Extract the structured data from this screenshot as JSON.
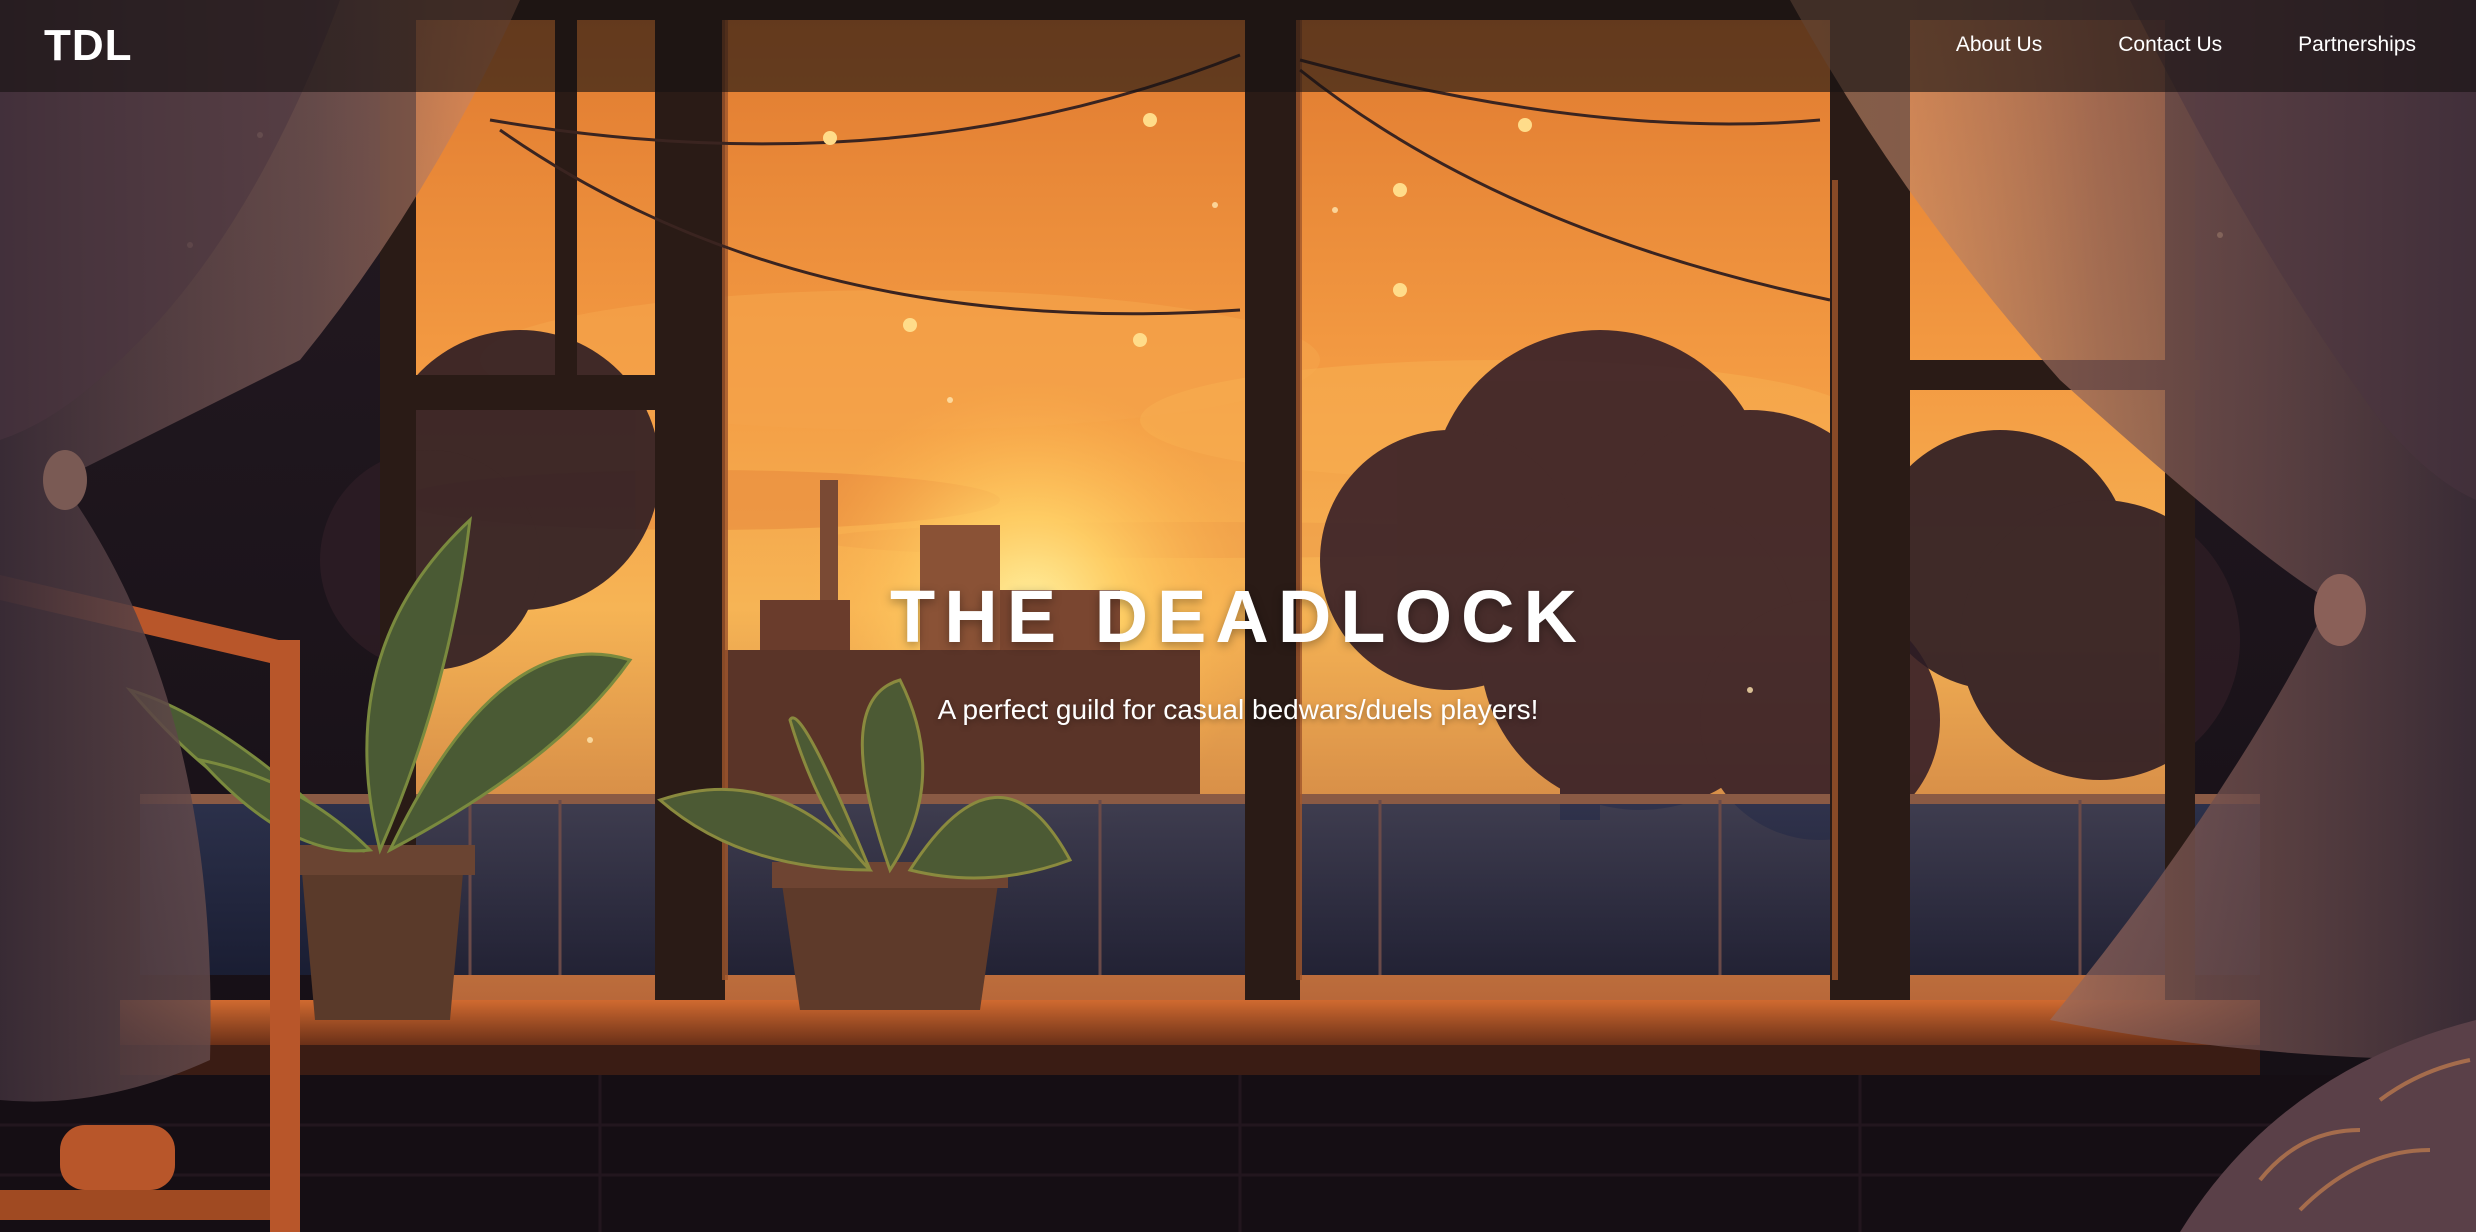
{
  "header": {
    "logo_text": "TDL",
    "nav": [
      {
        "label": "About Us"
      },
      {
        "label": "Contact Us"
      },
      {
        "label": "Partnerships"
      }
    ]
  },
  "hero": {
    "title": "THE DEADLOCK",
    "subtitle": "A perfect guild for casual bedwars/duels players!",
    "background_image": "sunset-window-room-illustration"
  },
  "colors": {
    "navbar_bg": "#161212",
    "text": "#ffffff",
    "sky_top": "#f08a36",
    "sky_glow": "#ffc45a",
    "sill": "#c25f2a",
    "frame": "#2a1b16"
  }
}
